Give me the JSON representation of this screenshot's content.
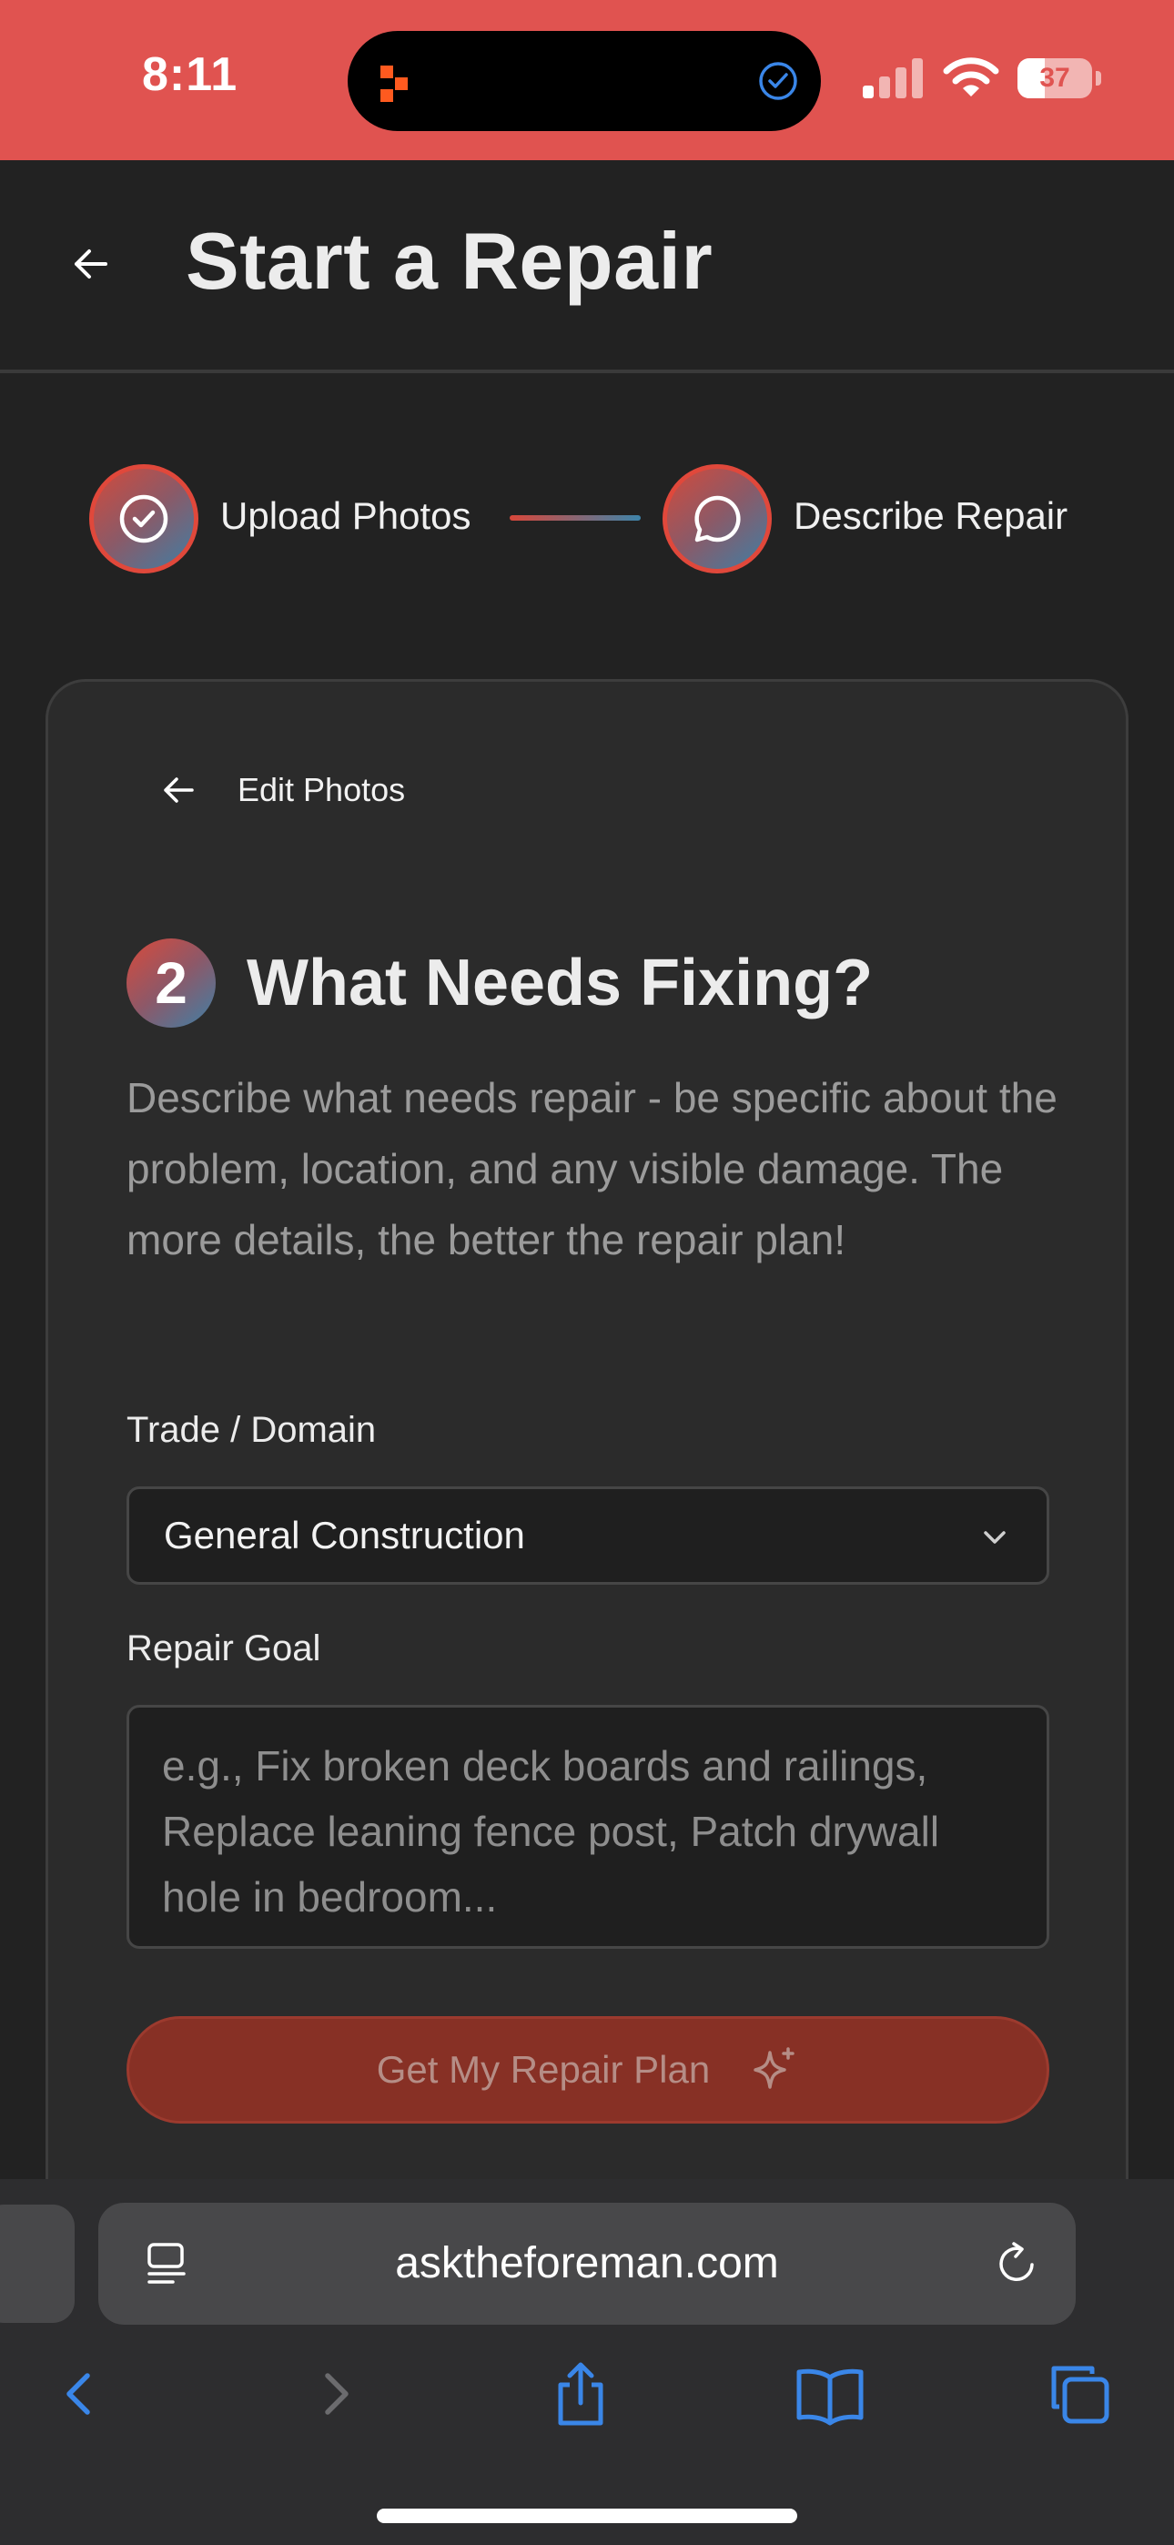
{
  "status_bar": {
    "time": "8:11",
    "battery": "37",
    "battery_level": 0.37,
    "bg_color": "#e05350"
  },
  "header": {
    "title": "Start a Repair"
  },
  "stepper": {
    "steps": [
      {
        "label": "Upload Photos",
        "icon": "check-circle-icon",
        "state": "complete"
      },
      {
        "label": "Describe Repair",
        "icon": "chat-bubble-icon",
        "state": "active"
      }
    ]
  },
  "card": {
    "edit_photos": "Edit Photos",
    "step_number": "2",
    "title": "What Needs Fixing?",
    "description": "Describe what needs repair - be specific about the problem, location, and any visible damage. The more details, the better the repair plan!",
    "trade": {
      "label": "Trade / Domain",
      "value": "General Construction"
    },
    "goal": {
      "label": "Repair Goal",
      "placeholder": "e.g., Fix broken deck boards and railings, Replace leaning fence post, Patch drywall hole in bedroom...",
      "value": ""
    },
    "submit_label": "Get My Repair Plan"
  },
  "browser": {
    "url": "asktheforeman.com"
  },
  "colors": {
    "accent_red": "#e0483b",
    "accent_blue": "#3f7ea4",
    "background": "#222222",
    "card": "#2b2b2b",
    "safari_blue": "#3a86e8"
  }
}
